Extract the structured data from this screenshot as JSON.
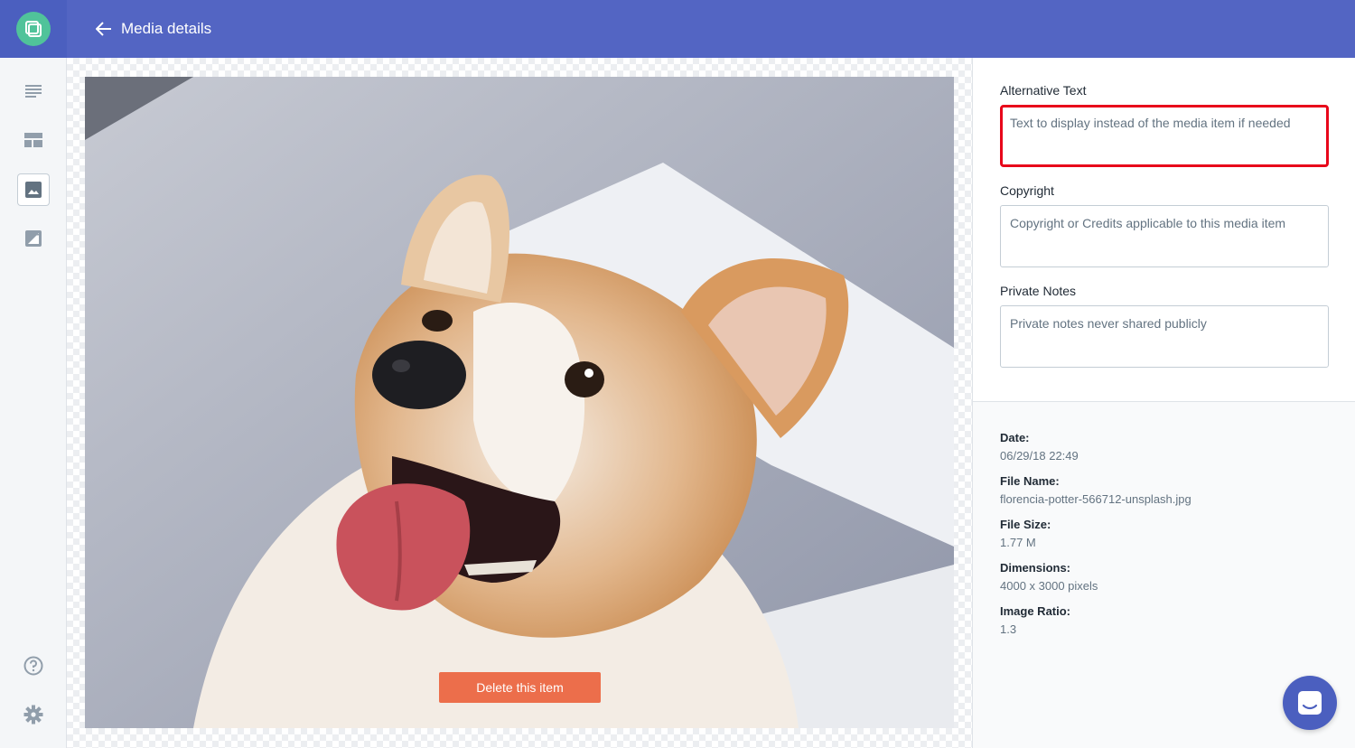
{
  "header": {
    "title": "Media details"
  },
  "sidebar": {
    "items": [
      {
        "name": "content-list"
      },
      {
        "name": "layouts"
      },
      {
        "name": "media"
      },
      {
        "name": "image-edit"
      },
      {
        "name": "help"
      },
      {
        "name": "settings"
      }
    ]
  },
  "preview": {
    "delete_label": "Delete this item"
  },
  "form": {
    "alt_text": {
      "label": "Alternative Text",
      "placeholder": "Text to display instead of the media item if needed",
      "value": ""
    },
    "copyright": {
      "label": "Copyright",
      "placeholder": "Copyright or Credits applicable to this media item",
      "value": ""
    },
    "notes": {
      "label": "Private Notes",
      "placeholder": "Private notes never shared publicly",
      "value": ""
    }
  },
  "meta": {
    "date_label": "Date:",
    "date_value": "06/29/18 22:49",
    "filename_label": "File Name:",
    "filename_value": "florencia-potter-566712-unsplash.jpg",
    "filesize_label": "File Size:",
    "filesize_value": "1.77 M",
    "dimensions_label": "Dimensions:",
    "dimensions_value": "4000 x 3000 pixels",
    "ratio_label": "Image Ratio:",
    "ratio_value": "1.3"
  },
  "colors": {
    "brand": "#5365c3",
    "accent": "#50c39a",
    "danger": "#ec6e4b",
    "highlight": "#e8061a"
  }
}
